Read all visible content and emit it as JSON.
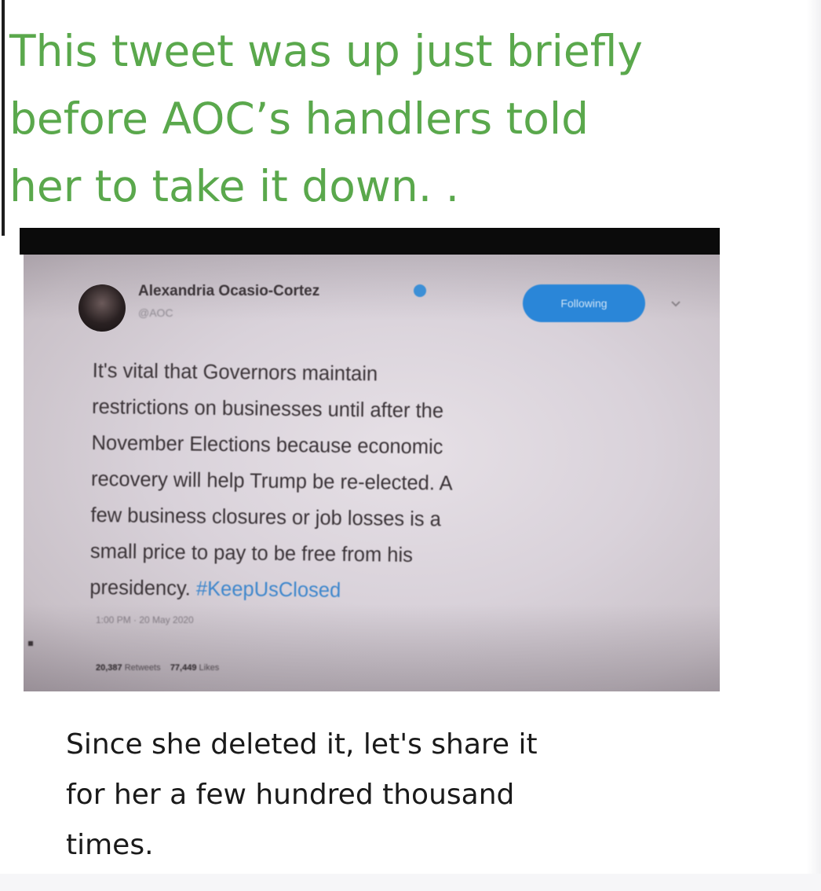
{
  "headline": {
    "line1": "This tweet was up just briefly",
    "line2": "before AOC’s handlers told",
    "line3": "her to take it down.  ."
  },
  "tweet": {
    "author_name": "Alexandria Ocasio-Cortez",
    "handle": "@AOC",
    "follow_label": "Following",
    "body_lines": [
      "It's vital that Governors maintain",
      "restrictions on businesses until after the",
      "November Elections because economic",
      "recovery will help Trump be re-elected. A",
      "few business closures or job losses is a",
      "small price to pay to be free from his"
    ],
    "body_last_prefix": "presidency. ",
    "hashtag": "#KeepUsClosed",
    "timestamp": "1:00 PM · 20 May 2020",
    "retweets_count": "20,387",
    "retweets_label": "Retweets",
    "likes_count": "77,449",
    "likes_label": "Likes"
  },
  "caption": {
    "line1": "Since she deleted it, let's share it",
    "line2": "for her a few hundred thousand",
    "line3": "times."
  },
  "colors": {
    "headline": "#5aa84c",
    "follow_button": "#2a86d8",
    "hashtag": "#3d86cc",
    "black_bar": "#0b0b0b"
  },
  "icons": {
    "verified": "verified-badge-icon",
    "menu": "chevron-down-icon"
  }
}
